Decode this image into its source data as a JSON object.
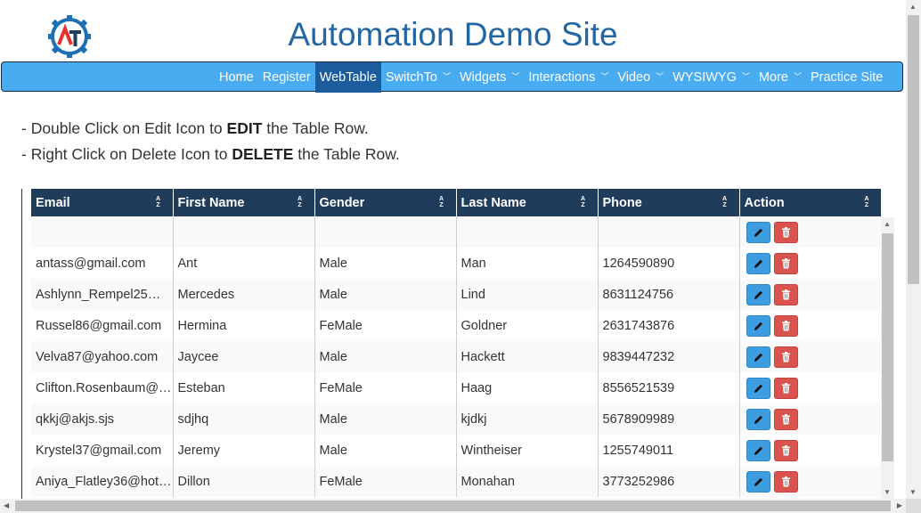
{
  "header": {
    "title": "Automation Demo Site",
    "logo_letters": "AT"
  },
  "nav": {
    "items": [
      {
        "label": "Home",
        "dropdown": false,
        "active": false
      },
      {
        "label": "Register",
        "dropdown": false,
        "active": false
      },
      {
        "label": "WebTable",
        "dropdown": false,
        "active": true
      },
      {
        "label": "SwitchTo",
        "dropdown": true,
        "active": false
      },
      {
        "label": "Widgets",
        "dropdown": true,
        "active": false
      },
      {
        "label": "Interactions",
        "dropdown": true,
        "active": false
      },
      {
        "label": "Video",
        "dropdown": true,
        "active": false
      },
      {
        "label": "WYSIWYG",
        "dropdown": true,
        "active": false
      },
      {
        "label": "More",
        "dropdown": true,
        "active": false
      },
      {
        "label": "Practice Site",
        "dropdown": false,
        "active": false
      }
    ]
  },
  "instructions": [
    {
      "prefix": "- Double Click on Edit Icon to ",
      "bold": "EDIT",
      "suffix": " the Table Row."
    },
    {
      "prefix": "- Right Click on Delete Icon to ",
      "bold": "DELETE",
      "suffix": " the Table Row."
    }
  ],
  "table": {
    "sort_icon_text": "AZ",
    "columns": [
      "Email",
      "First Name",
      "Gender",
      "Last Name",
      "Phone",
      "Action"
    ],
    "rows": [
      [
        "",
        "",
        "",
        "",
        ""
      ],
      [
        "antass@gmail.com",
        "Ant",
        "Male",
        "Man",
        "1264590890"
      ],
      [
        "Ashlynn_Rempel25…",
        "Mercedes",
        "Male",
        "Lind",
        "8631124756"
      ],
      [
        "Russel86@gmail.com",
        "Hermina",
        "FeMale",
        "Goldner",
        "2631743876"
      ],
      [
        "Velva87@yahoo.com",
        "Jaycee",
        "Male",
        "Hackett",
        "9839447232"
      ],
      [
        "Clifton.Rosenbaum@…",
        "Esteban",
        "FeMale",
        "Haag",
        "8556521539"
      ],
      [
        "qkkj@akjs.sjs",
        "sdjhq",
        "Male",
        "kjdkj",
        "5678909989"
      ],
      [
        "Krystel37@gmail.com",
        "Jeremy",
        "Male",
        "Wintheiser",
        "1255749011"
      ],
      [
        "Aniya_Flatley36@hot…",
        "Dillon",
        "FeMale",
        "Monahan",
        "3773252986"
      ]
    ]
  },
  "colors": {
    "title": "#2466a4",
    "navbar": "#4aacf0",
    "nav_active": "#1a5c9c",
    "table_header": "#1f3c5a",
    "edit_button": "#3e9ce0",
    "delete_button": "#d9534f"
  },
  "icons": {
    "edit": "pencil-icon",
    "delete": "trash-icon",
    "sort": "sort-alpha-icon",
    "dropdown": "chevron-down-icon"
  }
}
